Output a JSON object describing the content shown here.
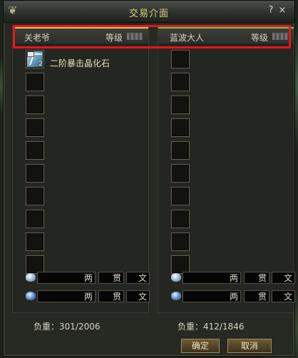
{
  "window": {
    "title": "交易介面",
    "help": "?",
    "close": "×"
  },
  "left_panel": {
    "player_name": "关老爷",
    "level_label": "等级",
    "items": [
      {
        "name": "二阶暴击晶化石",
        "count": "2"
      }
    ],
    "slot_count": 10,
    "money": {
      "row1": {
        "liang": "两",
        "guan": "贯",
        "wen": "文"
      },
      "row2": {
        "liang": "两",
        "guan": "贯",
        "wen": "文"
      }
    },
    "weight": "负重：301/2006"
  },
  "right_panel": {
    "player_name": "蓝波大人",
    "level_label": "等级",
    "items": [],
    "slot_count": 10,
    "money": {
      "row1": {
        "liang": "两",
        "guan": "贯",
        "wen": "文"
      },
      "row2": {
        "liang": "两",
        "guan": "贯",
        "wen": "文"
      }
    },
    "weight": "负重：412/1846"
  },
  "buttons": {
    "confirm": "确定",
    "cancel": "取消"
  },
  "colors": {
    "title": "#e2cf83",
    "left_accent": "#d6c66e",
    "right_accent": "#73c460",
    "highlight": "#e8151b"
  },
  "icons": [
    "swirl-icon",
    "crystal-icon",
    "coin-silver-icon",
    "gem-icon",
    "level-flag-icon"
  ]
}
